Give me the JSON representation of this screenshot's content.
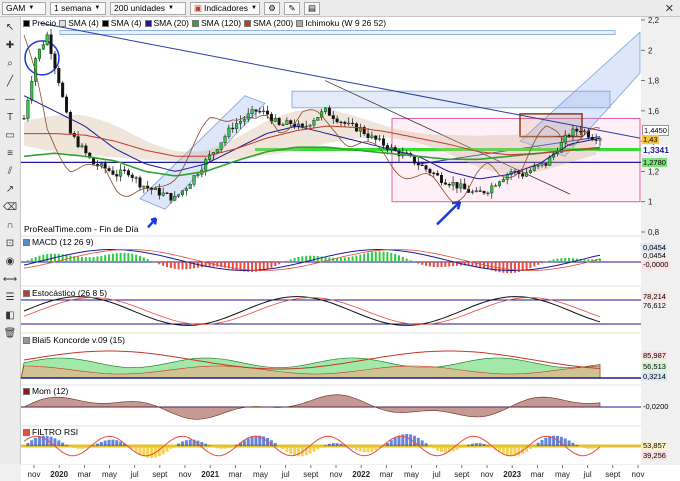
{
  "toolbar": {
    "symbol": "GAM",
    "timeframe": "1 semana",
    "units": "200 unidades",
    "indicators": "Indicadores"
  },
  "main_legend": [
    {
      "label": "Precio",
      "color": "#000000"
    },
    {
      "label": "SMA (4)",
      "color": "#e0e0e0"
    },
    {
      "label": "SMA (4)",
      "color": "#000000"
    },
    {
      "label": "SMA (20)",
      "color": "#1a1a99"
    },
    {
      "label": "SMA (120)",
      "color": "#2ea32e"
    },
    {
      "label": "SMA (200)",
      "color": "#c0392b"
    },
    {
      "label": "Ichimoku (W 9 26 52)",
      "color": "#aaaaaa"
    }
  ],
  "source_note": "ProRealTime.com - Fin de Día",
  "panels": {
    "macd": {
      "title": "MACD (12 26 9)",
      "values": [
        "0,0454",
        "0,0454",
        "-0,0000"
      ]
    },
    "stoch": {
      "title": "Estocástico (26 8 5)",
      "values": [
        "78,214",
        "76,612"
      ]
    },
    "blai": {
      "title": "Blai5 Koncorde v.09 (15)",
      "values": [
        "85,987",
        "56,513",
        "0,3214"
      ]
    },
    "mom": {
      "title": "Mom (12)",
      "values": [
        "-0,0200"
      ]
    },
    "rsi": {
      "title": "FILTRO RSI",
      "values": [
        "53,857",
        "39,256"
      ]
    }
  },
  "price_labels": {
    "current": "1,4450",
    "bid": "1,43",
    "support": "1,3341",
    "lower": "1,2780"
  },
  "chart_data": {
    "type": "candlestick",
    "title": "",
    "xlabel": "",
    "ylabel": "",
    "x_ticks": [
      "nov",
      "2020",
      "mar",
      "may",
      "jul",
      "sept",
      "nov",
      "2021",
      "mar",
      "may",
      "jul",
      "sept",
      "nov",
      "2022",
      "mar",
      "may",
      "jul",
      "sept",
      "nov",
      "2023",
      "mar",
      "may",
      "jul",
      "sept",
      "nov"
    ],
    "y_ticks": [
      "2,2",
      "2",
      "1,8",
      "1,6",
      "1,4",
      "1,2",
      "1",
      "0,8"
    ],
    "ylim": [
      0.8,
      2.2
    ],
    "grid": false,
    "legend": "top-left",
    "close_path": [
      [
        0,
        1.55
      ],
      [
        3,
        1.95
      ],
      [
        6,
        2.1
      ],
      [
        9,
        1.8
      ],
      [
        12,
        1.45
      ],
      [
        15,
        1.35
      ],
      [
        18,
        1.25
      ],
      [
        21,
        1.22
      ],
      [
        24,
        1.18
      ],
      [
        27,
        1.2
      ],
      [
        30,
        1.12
      ],
      [
        33,
        1.08
      ],
      [
        36,
        1.05
      ],
      [
        39,
        1.02
      ],
      [
        42,
        1.1
      ],
      [
        45,
        1.2
      ],
      [
        48,
        1.3
      ],
      [
        51,
        1.4
      ],
      [
        54,
        1.5
      ],
      [
        57,
        1.55
      ],
      [
        60,
        1.6
      ],
      [
        63,
        1.58
      ],
      [
        66,
        1.5
      ],
      [
        69,
        1.52
      ],
      [
        72,
        1.48
      ],
      [
        75,
        1.55
      ],
      [
        78,
        1.6
      ],
      [
        81,
        1.55
      ],
      [
        84,
        1.5
      ],
      [
        87,
        1.48
      ],
      [
        90,
        1.42
      ],
      [
        93,
        1.38
      ],
      [
        96,
        1.33
      ],
      [
        99,
        1.3
      ],
      [
        102,
        1.25
      ],
      [
        105,
        1.2
      ],
      [
        108,
        1.15
      ],
      [
        111,
        1.12
      ],
      [
        114,
        1.08
      ],
      [
        117,
        1.05
      ],
      [
        120,
        1.08
      ],
      [
        123,
        1.15
      ],
      [
        126,
        1.2
      ],
      [
        129,
        1.18
      ],
      [
        132,
        1.22
      ],
      [
        135,
        1.25
      ],
      [
        138,
        1.35
      ],
      [
        141,
        1.45
      ],
      [
        144,
        1.48
      ],
      [
        147,
        1.43
      ]
    ],
    "x_count": 150,
    "series": [
      {
        "name": "SMA (20)",
        "values": [
          1.7,
          1.6,
          1.5,
          1.35,
          1.25,
          1.2,
          1.25,
          1.35,
          1.45,
          1.5,
          1.45,
          1.4,
          1.35,
          1.3,
          1.2,
          1.15,
          1.18,
          1.25,
          1.38,
          1.42
        ]
      },
      {
        "name": "SMA (120)",
        "values": [
          1.3,
          1.32,
          1.3,
          1.27,
          1.2,
          1.17,
          1.2,
          1.27,
          1.33,
          1.36,
          1.36,
          1.34,
          1.32,
          1.3,
          1.28,
          1.28,
          1.3,
          1.32,
          1.34,
          1.35
        ]
      },
      {
        "name": "SMA (200)",
        "values": [
          1.45,
          1.45,
          1.44,
          1.4,
          1.34,
          1.3,
          1.3,
          1.35,
          1.42,
          1.47,
          1.5,
          1.49,
          1.46,
          1.42,
          1.38,
          1.33,
          1.31,
          1.32,
          1.34,
          1.36
        ]
      }
    ]
  }
}
